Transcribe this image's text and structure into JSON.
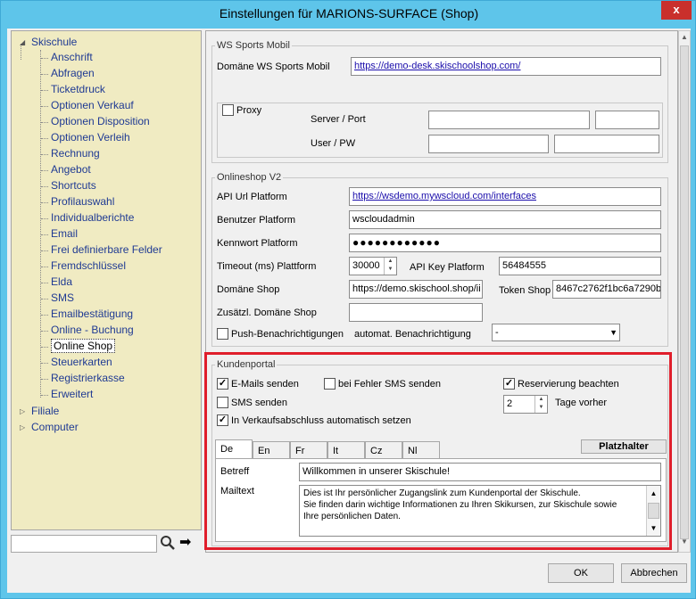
{
  "window": {
    "title": "Einstellungen für MARIONS-SURFACE (Shop)",
    "close": "x"
  },
  "tree": {
    "root1": "Skischule",
    "items": [
      "Anschrift",
      "Abfragen",
      "Ticketdruck",
      "Optionen Verkauf",
      "Optionen Disposition",
      "Optionen Verleih",
      "Rechnung",
      "Angebot",
      "Shortcuts",
      "Profilauswahl",
      "Individualberichte",
      "Email",
      "Frei definierbare Felder",
      "Fremdschlüssel",
      "Elda",
      "SMS",
      "Emailbestätigung",
      "Online - Buchung",
      "Online Shop",
      "Steuerkarten",
      "Registrierkasse",
      "Erweitert"
    ],
    "root2": "Filiale",
    "root3": "Computer",
    "selected": "Online Shop",
    "search_value": ""
  },
  "ws_sports": {
    "group_label": "WS Sports Mobil",
    "domain_label": "Domäne WS Sports Mobil",
    "domain_value": "https://demo-desk.skischoolshop.com/",
    "proxy_label": "Proxy",
    "proxy_checked": false,
    "server_label": "Server / Port",
    "user_label": "User / PW"
  },
  "onlineshop": {
    "group_label": "Onlineshop V2",
    "api_url_label": "API Url Platform",
    "api_url_value": "https://wsdemo.mywscloud.com/interfaces",
    "user_label": "Benutzer Platform",
    "user_value": "wscloudadmin",
    "password_label": "Kennwort Platform",
    "password_value": "●●●●●●●●●●●●",
    "timeout_label": "Timeout (ms) Plattform",
    "timeout_value": "30000",
    "apikey_label": "API Key Platform",
    "apikey_value": "56484555",
    "domain_label": "Domäne Shop",
    "domain_value": "https://demo.skischool.shop/ii",
    "token_label": "Token Shop",
    "token_value": "8467c2762f1bc6a7290b",
    "extra_domain_label": "Zusätzl. Domäne Shop",
    "extra_domain_value": "",
    "push_label": "Push-Benachrichtigungen",
    "push_checked": false,
    "auto_label": "automat. Benachrichtigung",
    "auto_value": "-"
  },
  "kundenportal": {
    "group_label": "Kundenportal",
    "emails_label": "E-Mails senden",
    "emails_checked": true,
    "sms_error_label": "bei Fehler SMS senden",
    "sms_error_checked": false,
    "reservierung_label": "Reservierung beachten",
    "reservierung_checked": true,
    "sms_label": "SMS senden",
    "sms_checked": false,
    "days_value": "2",
    "days_label": "Tage vorher",
    "verkauf_label": "In Verkaufsabschluss automatisch setzen",
    "verkauf_checked": true,
    "tabs": [
      "De",
      "En",
      "Fr",
      "It",
      "Cz",
      "Nl"
    ],
    "active_tab": "De",
    "placeholder_button": "Platzhalter",
    "betreff_label": "Betreff",
    "betreff_value": "Willkommen in unserer Skischule!",
    "mailtext_label": "Mailtext",
    "mailtext_lines": [
      "Dies ist Ihr persönlicher Zugangslink zum Kundenportal der Skischule.",
      "Sie finden darin wichtige Informationen zu Ihren Skikursen, zur Skischule sowie",
      "Ihre persönlichen Daten."
    ]
  },
  "footer": {
    "ok": "OK",
    "cancel": "Abbrechen"
  },
  "colors": {
    "titlebar": "#5ec5ea",
    "tree_bg": "#f0ebc2",
    "highlight": "#e01e2b",
    "close": "#c9302c"
  }
}
